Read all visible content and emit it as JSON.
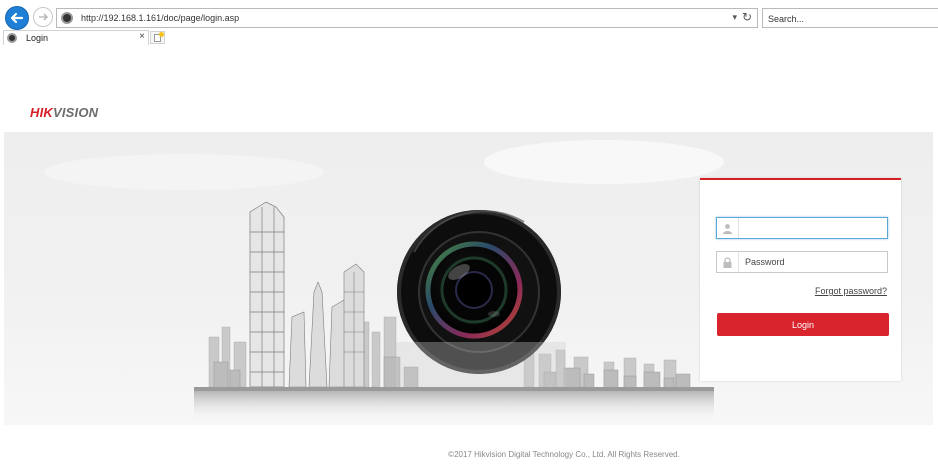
{
  "browser": {
    "url": "http://192.168.1.161/doc/page/login.asp",
    "search_placeholder": "Search...",
    "tab_title": "Login",
    "tab_close": "×"
  },
  "brand": {
    "logo_part1": "HIK",
    "logo_part2": "VISION",
    "brand_color": "#d71f26"
  },
  "login": {
    "username_value": "",
    "password_placeholder": "Password",
    "forgot_label": "Forgot password?",
    "login_label": "Login",
    "accent_color": "#d9232d"
  },
  "footer": {
    "copyright": "©2017 Hikvision Digital Technology Co., Ltd. All Rights Reserved."
  }
}
